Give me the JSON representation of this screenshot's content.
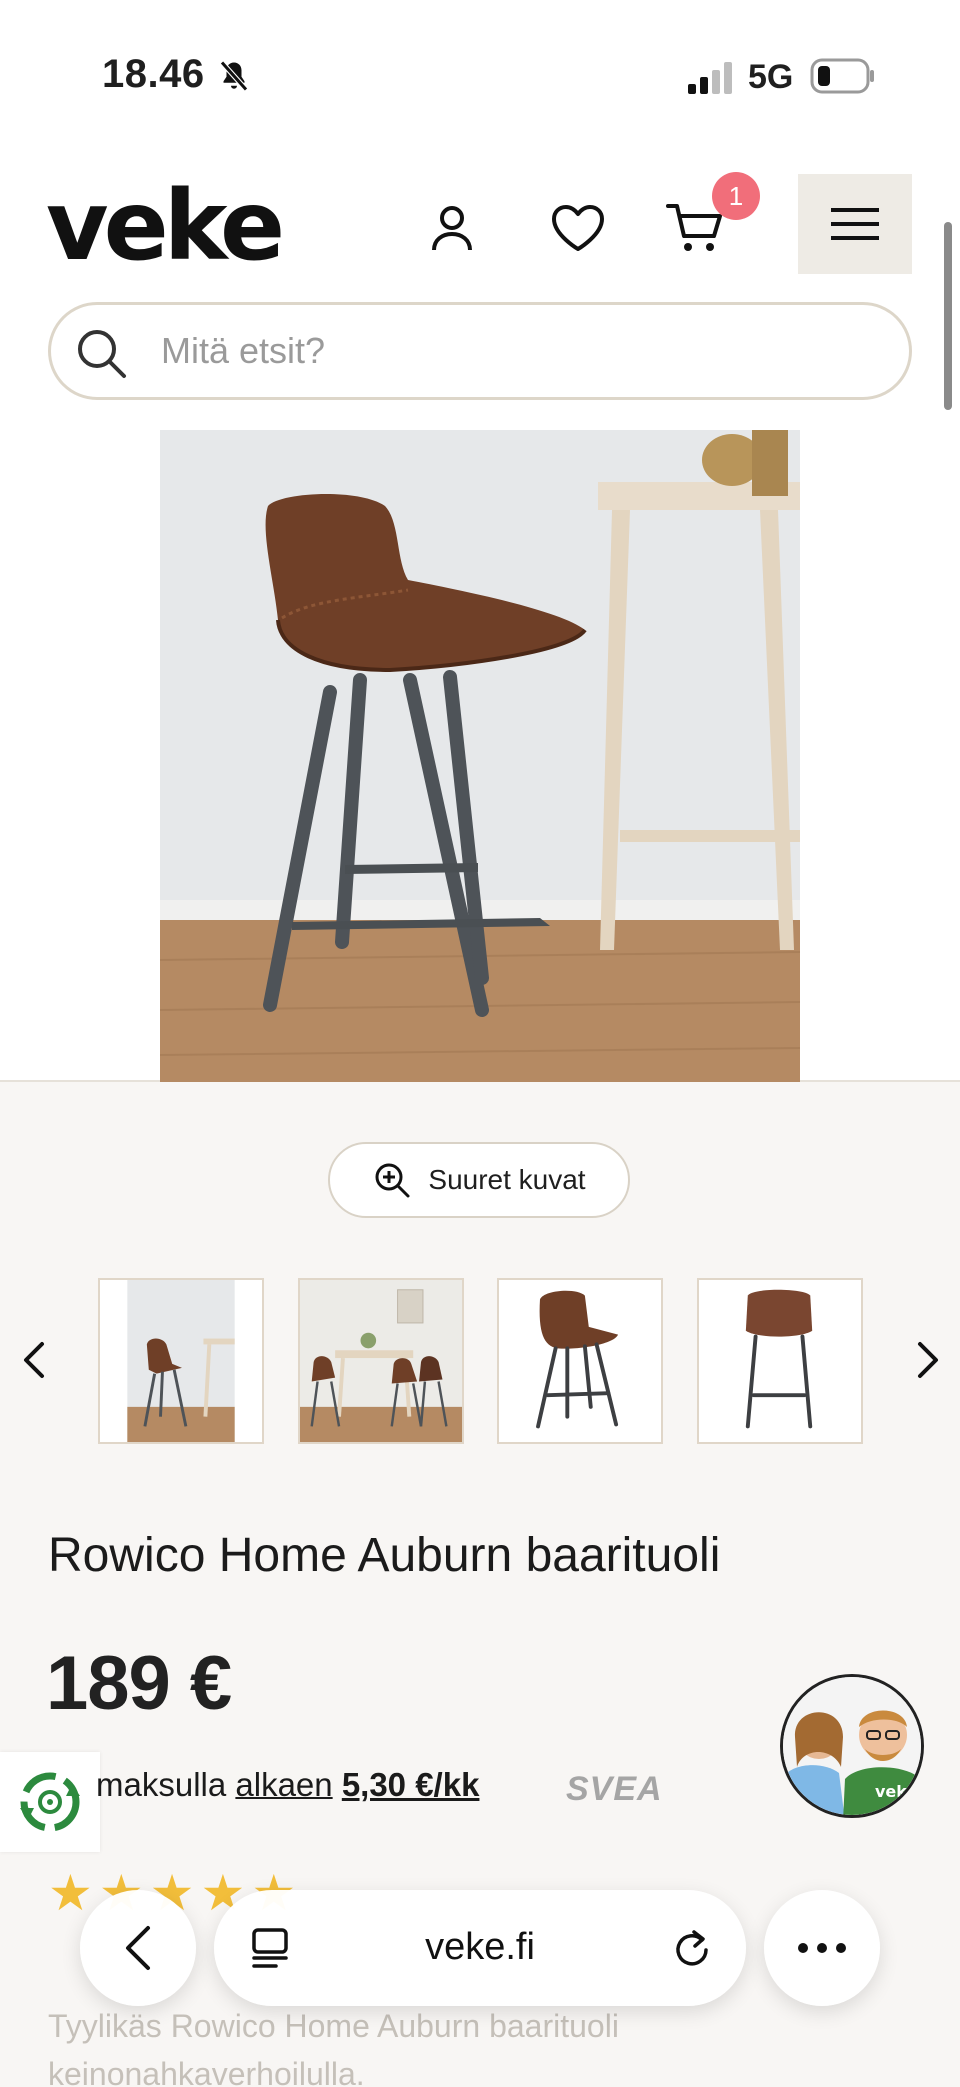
{
  "status_bar": {
    "time": "18.46",
    "network": "5G"
  },
  "header": {
    "logo": "veke",
    "cart_count": "1",
    "search": {
      "placeholder": "Mitä etsit?",
      "value": ""
    },
    "icons": [
      "user-icon",
      "heart-icon",
      "cart-icon",
      "menu-icon",
      "search-icon"
    ]
  },
  "gallery": {
    "zoom_label": "Suuret kuvat",
    "thumbnail_count": 4
  },
  "product": {
    "title": "Rowico Home Auburn baarituoli",
    "price": "189 €",
    "installment_prefix": "maksulla",
    "installment_link": "alkaen",
    "installment_amount": "5,30 €/kk",
    "payment_provider": "SVEA",
    "rating_stars": 5,
    "description": "Tyylikäs Rowico Home Auburn baarituoli keinonahkaverhoilulla."
  },
  "browser": {
    "address": "veke.fi"
  },
  "colors": {
    "badge": "#f16e7a",
    "menu_bg": "#eeebe5",
    "star": "#f2b51b",
    "page_bg": "#f8f6f4"
  }
}
